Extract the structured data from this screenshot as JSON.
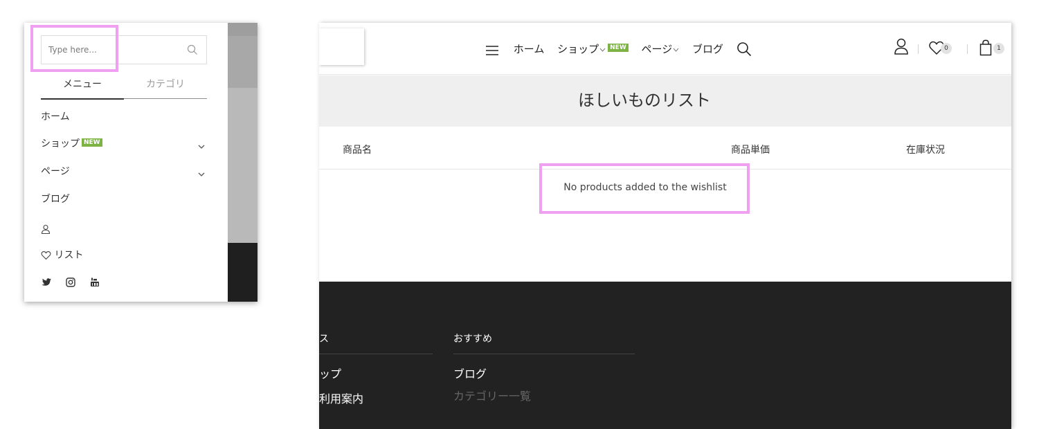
{
  "mobile": {
    "search": {
      "placeholder": "Type here..."
    },
    "tabs": [
      {
        "label": "メニュー"
      },
      {
        "label": "カテゴリ"
      }
    ],
    "menu": {
      "home": "ホーム",
      "shop": "ショップ",
      "shop_badge": "NEW",
      "pages": "ページ",
      "blog": "ブログ",
      "wishlist": "リスト"
    },
    "social": [
      "twitter-icon",
      "instagram-icon",
      "youtube-icon"
    ]
  },
  "site": {
    "nav": {
      "home": "ホーム",
      "shop": "ショップ",
      "shop_badge": "NEW",
      "pages": "ページ",
      "blog": "ブログ"
    },
    "wishlist_count": "0",
    "cart_count": "1",
    "page_title": "ほしいものリスト",
    "table": {
      "col_name": "商品名",
      "col_price": "商品単価",
      "col_stock": "在庫状況"
    },
    "empty_message": "No products added to the wishlist",
    "footer": {
      "col1_title_partial": "ス",
      "col1_links": [
        "ップ",
        "利用案内"
      ],
      "col2_title": "おすすめ",
      "col2_links": [
        "ブログ",
        "カテゴリー一覧"
      ]
    },
    "accent_badge_color": "#7cb342",
    "highlight_color": "#f0a0f0"
  }
}
